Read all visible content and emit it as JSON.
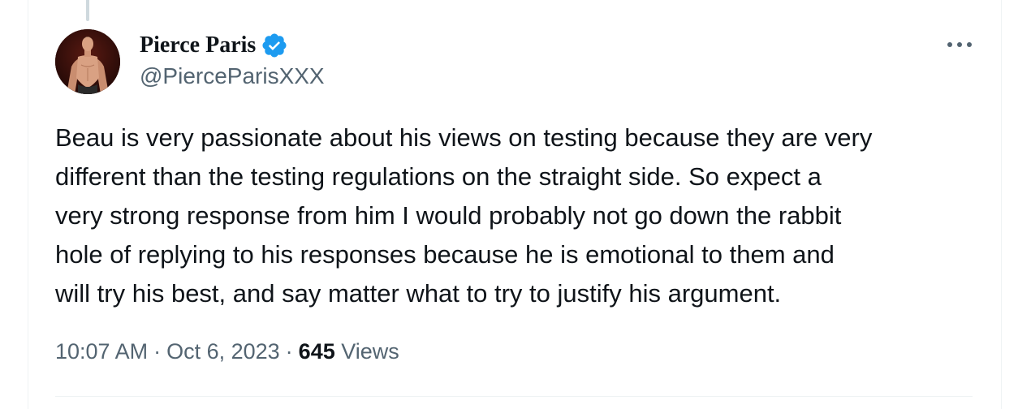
{
  "tweet": {
    "author": {
      "display_name": "Pierce Paris",
      "handle": "@PierceParisXXX",
      "verified": true
    },
    "text": "Beau is very passionate about his views on testing because they are very\ndifferent than the testing regulations on the straight side. So expect a\nvery strong response from him I would probably not go down the rabbit\nhole of replying to his responses because he is emotional to them and\nwill try his best, and say matter what to try to justify his argument.",
    "time": "10:07 AM",
    "date": "Oct 6, 2023",
    "separator": "·",
    "views_count": "645",
    "views_label": "Views"
  },
  "icons": {
    "verified": "verified-badge-icon",
    "more": "more-options-icon"
  },
  "colors": {
    "verified_blue": "#1d9bf0",
    "text_primary": "#0f1419",
    "text_secondary": "#536471",
    "border": "#eff3f4"
  }
}
